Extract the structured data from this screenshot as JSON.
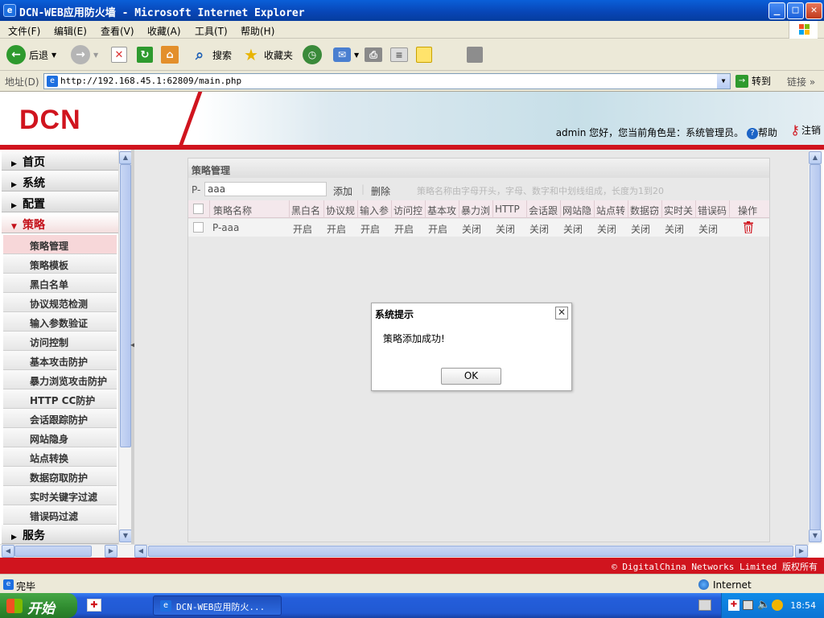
{
  "window": {
    "title": "DCN-WEB应用防火墙 - Microsoft Internet Explorer",
    "controls": [
      "_",
      "□",
      "✕"
    ]
  },
  "menu": [
    "文件(F)",
    "编辑(E)",
    "查看(V)",
    "收藏(A)",
    "工具(T)",
    "帮助(H)"
  ],
  "toolbar": {
    "back": "后退",
    "search": "搜索",
    "favorites": "收藏夹"
  },
  "address": {
    "label": "地址(D)",
    "url": "http://192.168.45.1:62809/main.php",
    "go": "转到",
    "links": "链接"
  },
  "header": {
    "logo": "DCN",
    "user": "admin",
    "greeting": "您好，您当前角色是：系统管理员。",
    "help": "帮助",
    "logout": "注销"
  },
  "sidebar": {
    "groups": [
      {
        "label": "首页",
        "active": false
      },
      {
        "label": "系统",
        "active": false
      },
      {
        "label": "配置",
        "active": false
      },
      {
        "label": "策略",
        "active": true
      }
    ],
    "items": [
      "策略管理",
      "策略模板",
      "黑白名单",
      "协议规范检测",
      "输入参数验证",
      "访问控制",
      "基本攻击防护",
      "暴力浏览攻击防护",
      "HTTP CC防护",
      "会话跟踪防护",
      "网站隐身",
      "站点转换",
      "数据窃取防护",
      "实时关键字过滤",
      "错误码过滤"
    ],
    "selected_item": "策略管理",
    "bottom_group": "服务"
  },
  "panel": {
    "title": "策略管理",
    "prefix": "P-",
    "filter_value": "aaa",
    "add": "添加",
    "delete": "删除",
    "hint": "策略名称由字母开头，字母、数字和中划线组成，长度为1到20"
  },
  "table": {
    "headers": [
      "策略名称",
      "黑白名",
      "协议规",
      "输入参",
      "访问控",
      "基本攻",
      "暴力浏",
      "HTTP",
      "会话跟",
      "网站隐",
      "站点转",
      "数据窃",
      "实时关",
      "错误码",
      "操作"
    ],
    "rows": [
      [
        "P-aaa",
        "开启",
        "开启",
        "开启",
        "开启",
        "开启",
        "关闭",
        "关闭",
        "关闭",
        "关闭",
        "关闭",
        "关闭",
        "关闭",
        "关闭"
      ]
    ],
    "action_icon": "trash-icon"
  },
  "dialog": {
    "title": "系统提示",
    "message": "策略添加成功!",
    "ok": "OK",
    "close": "✕"
  },
  "footer": "© DigitalChina Networks Limited 版权所有",
  "status": {
    "left": "完毕",
    "zone": "Internet"
  },
  "taskbar": {
    "start": "开始",
    "task": "DCN-WEB应用防火...",
    "clock": "18:54"
  }
}
